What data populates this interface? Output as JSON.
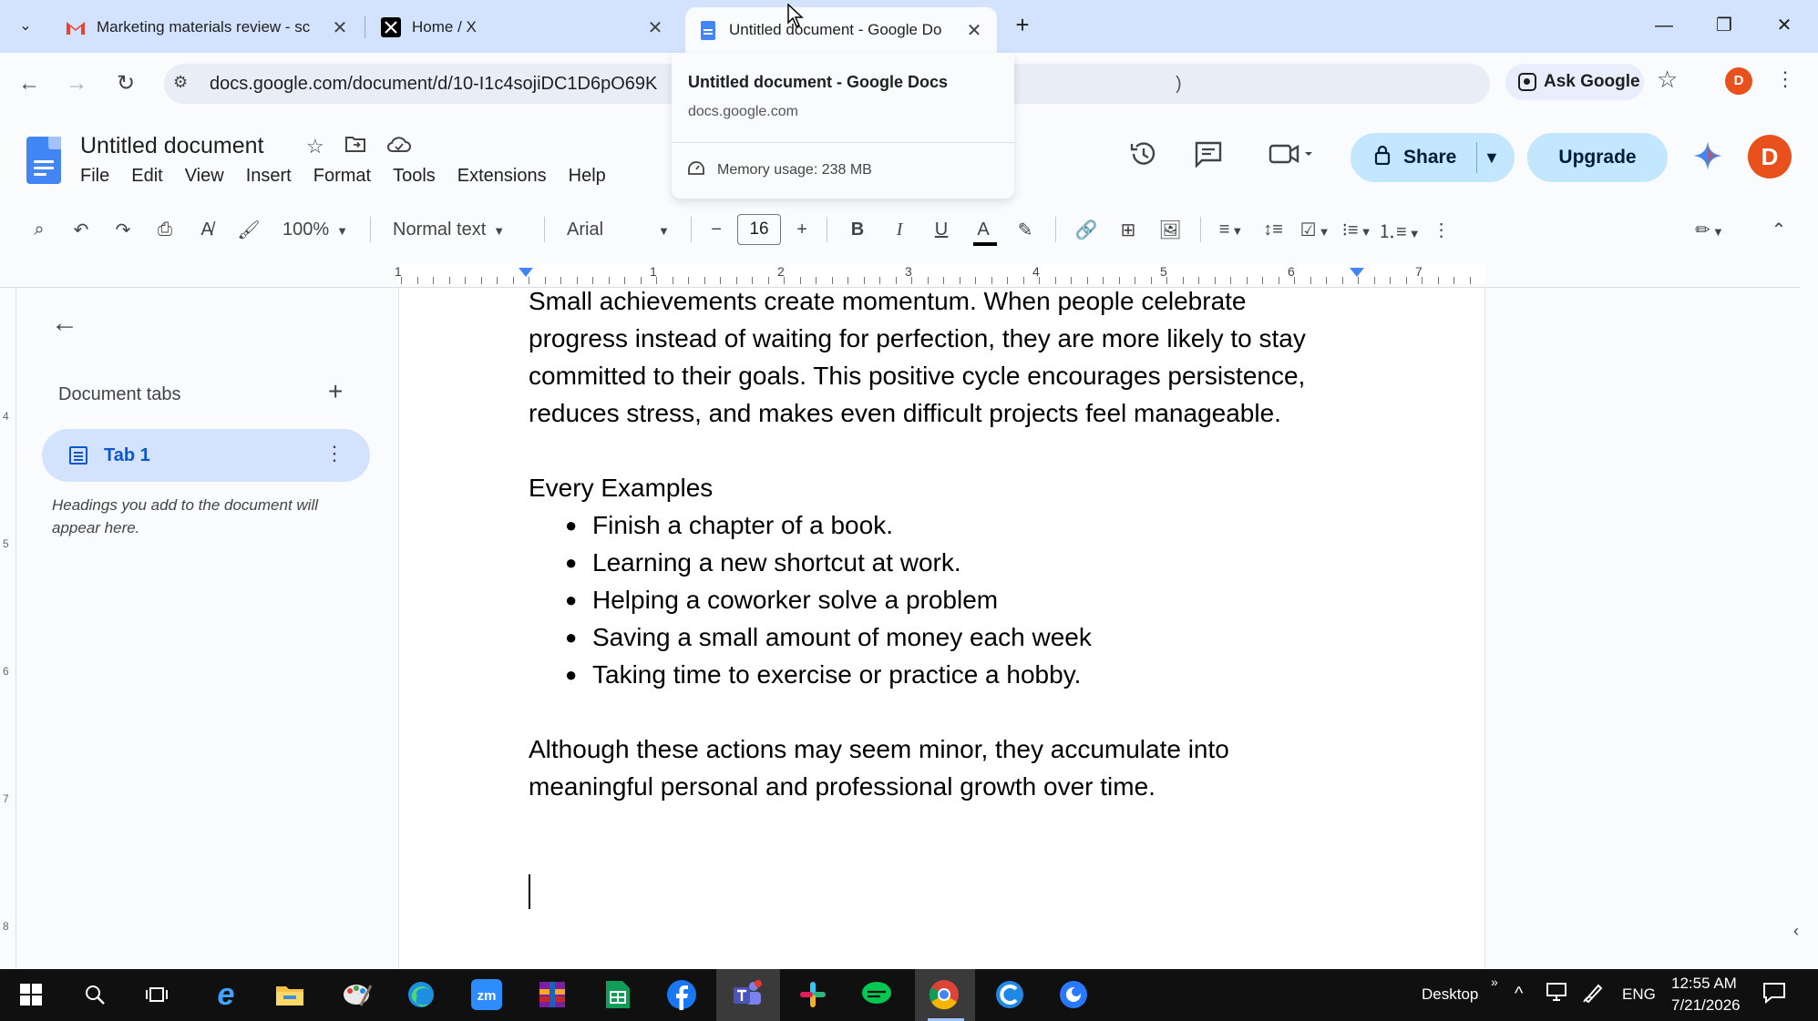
{
  "browser": {
    "tabs": [
      {
        "title": "Marketing materials review - sc",
        "favicon": "gmail-icon"
      },
      {
        "title": "Home / X",
        "favicon": "x-icon"
      },
      {
        "title": "Untitled document - Google Do",
        "favicon": "docs-icon"
      }
    ],
    "url": "docs.google.com/document/d/10-I1c4sojiDC1D6pO69K",
    "url_tail": ")",
    "ask_google": "Ask Google",
    "profile_initial": "D",
    "hover_card": {
      "title": "Untitled document - Google Docs",
      "domain": "docs.google.com",
      "memory": "Memory usage: 238 MB"
    }
  },
  "docs": {
    "title": "Untitled document",
    "menu": [
      "File",
      "Edit",
      "View",
      "Insert",
      "Format",
      "Tools",
      "Extensions",
      "Help"
    ],
    "share_label": "Share",
    "upgrade_label": "Upgrade",
    "profile_initial": "D",
    "toolbar": {
      "zoom": "100%",
      "style": "Normal text",
      "font": "Arial",
      "font_size": "16"
    },
    "ruler_numbers": [
      "1",
      "1",
      "2",
      "3",
      "4",
      "5",
      "6",
      "7"
    ],
    "vruler_numbers": [
      "4",
      "5",
      "6",
      "7",
      "8"
    ],
    "outline": {
      "heading": "Document tabs",
      "tab_label": "Tab 1",
      "hint": "Headings you add to the document will appear here."
    },
    "content": {
      "para1": "Small achievements create momentum. When people celebrate progress instead of waiting for perfection, they are more likely to stay committed to their goals. This positive cycle encourages persistence, reduces stress, and makes even difficult projects feel manageable.",
      "heading": "Every Examples",
      "bullets": [
        "Finish a chapter of a book.",
        "Learning a new shortcut at work.",
        "Helping a coworker solve a problem",
        "Saving a small amount of money each week",
        "Taking time to exercise or practice a hobby."
      ],
      "para2": "Although these actions may seem minor, they accumulate into meaningful personal and professional growth over time."
    }
  },
  "taskbar": {
    "desktop_label": "Desktop",
    "language": "ENG",
    "time": "12:55 AM",
    "date": "7/21/2026",
    "zoom_label": "zm"
  },
  "colors": {
    "tabstrip": "#d3e3fd",
    "share_button": "#c2e7ff",
    "docs_blue": "#4285f4",
    "avatar": "#e8501c",
    "taskbar": "#101010"
  }
}
